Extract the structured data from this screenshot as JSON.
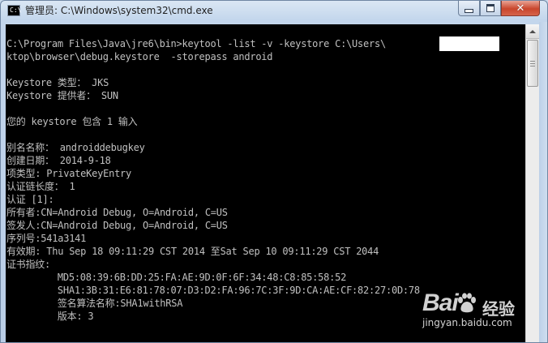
{
  "window": {
    "title": "管理员: C:\\Windows\\system32\\cmd.exe",
    "icon_text": "C:\\"
  },
  "console": {
    "lines": [
      "",
      "C:\\Program Files\\Java\\jre6\\bin>keytool -list -v -keystore C:\\Users\\          \\Des",
      "ktop\\browser\\debug.keystore  -storepass android",
      "",
      "Keystore 类型： JKS",
      "Keystore 提供者： SUN",
      "",
      "您的 keystore 包含 1 输入",
      "",
      "别名名称： androiddebugkey",
      "创建日期： 2014-9-18",
      "项类型: PrivateKeyEntry",
      "认证链长度： 1",
      "认证 [1]:",
      "所有者:CN=Android Debug, O=Android, C=US",
      "签发人:CN=Android Debug, O=Android, C=US",
      "序列号:541a3141",
      "有效期: Thu Sep 18 09:11:29 CST 2014 至Sat Sep 10 09:11:29 CST 2044",
      "证书指纹:",
      "         MD5:08:39:6B:DD:25:FA:AE:9D:0F:6F:34:48:C8:85:58:52",
      "         SHA1:3B:31:E6:81:78:07:D3:D2:FA:96:7C:3F:9D:CA:AE:CF:82:27:0D:78",
      "         签名算法名称:SHA1withRSA",
      "         版本: 3"
    ]
  },
  "watermark": {
    "logo": "Bai 经验",
    "url": "jingyan.baidu.com"
  },
  "colors": {
    "console_bg": "#000000",
    "console_text": "#c0c0c0",
    "close_button": "#c9462c"
  },
  "icons": [
    "cmd-app-icon",
    "minimize-icon",
    "maximize-icon",
    "close-icon",
    "scroll-up-arrow-icon"
  ]
}
